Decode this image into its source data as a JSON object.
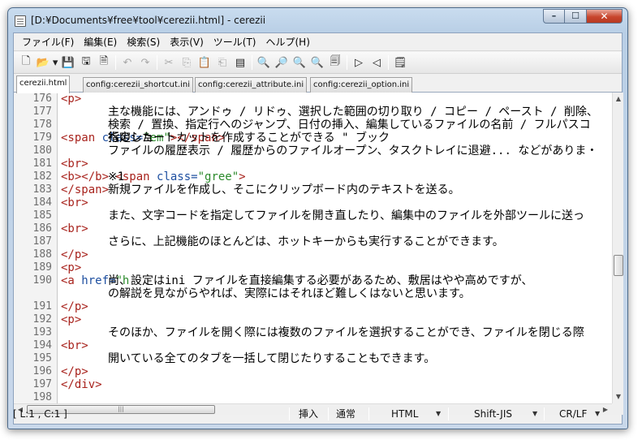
{
  "window": {
    "title": "[D:¥Documents¥free¥tool¥cerezii.html] - cerezii"
  },
  "menu": [
    "ファイル(F)",
    "編集(E)",
    "検索(S)",
    "表示(V)",
    "ツール(T)",
    "ヘルプ(H)"
  ],
  "toolbar": {
    "icons": [
      {
        "name": "new-file-icon",
        "glyph": "🗋",
        "enabled": true
      },
      {
        "name": "open-file-icon",
        "glyph": "📂",
        "enabled": true
      },
      {
        "name": "save-icon",
        "glyph": "💾",
        "enabled": true
      },
      {
        "name": "save-as-icon",
        "glyph": "🖫",
        "enabled": true
      },
      {
        "name": "close-file-icon",
        "glyph": "🗎",
        "enabled": true
      },
      {
        "name": "undo-icon",
        "glyph": "↶",
        "enabled": false
      },
      {
        "name": "redo-icon",
        "glyph": "↷",
        "enabled": false
      },
      {
        "name": "cut-icon",
        "glyph": "✂",
        "enabled": false
      },
      {
        "name": "copy-icon",
        "glyph": "⎘",
        "enabled": false
      },
      {
        "name": "paste-icon",
        "glyph": "📋",
        "enabled": true
      },
      {
        "name": "paste-special-icon",
        "glyph": "⎗",
        "enabled": false
      },
      {
        "name": "select-all-icon",
        "glyph": "▤",
        "enabled": true
      },
      {
        "name": "find-icon",
        "glyph": "🔍",
        "enabled": true
      },
      {
        "name": "find-next-icon",
        "glyph": "🔎",
        "enabled": true
      },
      {
        "name": "find-prev-icon",
        "glyph": "🔍",
        "enabled": true
      },
      {
        "name": "replace-icon",
        "glyph": "🔍",
        "enabled": true
      },
      {
        "name": "go-to-line-icon",
        "glyph": "🗐",
        "enabled": true
      },
      {
        "name": "next-tab-icon",
        "glyph": "▷",
        "enabled": true
      },
      {
        "name": "prev-tab-icon",
        "glyph": "◁",
        "enabled": true
      },
      {
        "name": "properties-icon",
        "glyph": "🗒",
        "enabled": true
      }
    ]
  },
  "tabs": [
    {
      "label": "cerezii.html",
      "active": true
    },
    {
      "label": "config:cerezii_shortcut.ini",
      "active": false
    },
    {
      "label": "config:cerezii_attribute.ini",
      "active": false
    },
    {
      "label": "config:cerezii_option.ini",
      "active": false
    }
  ],
  "editor": {
    "lines": [
      {
        "num": "176",
        "segs": [
          [
            "tag",
            "<p>"
          ]
        ]
      },
      {
        "num": "177",
        "segs": [
          [
            "txt",
            "主な機能には、アンドゥ / リドゥ、選択した範囲の切り取り / コピー / ペースト / 削除、"
          ]
        ]
      },
      {
        "num": "178",
        "segs": [
          [
            "txt",
            "検索 / 置換、指定行へのジャンプ、日付の挿入、編集しているファイルの名前 / フルパスコ"
          ]
        ]
      },
      {
        "num": "179",
        "segs": [
          [
            "txt",
            "指定した"
          ],
          [
            "tag",
            "<span "
          ],
          [
            "attr",
            "class="
          ],
          [
            "val",
            "\"em\""
          ],
          [
            "tag",
            ">"
          ],
          [
            "txt",
            "行"
          ],
          [
            "tag",
            "</span>"
          ],
          [
            "txt",
            "へのショートカットを作成することができる \" ブック"
          ]
        ]
      },
      {
        "num": "180",
        "segs": [
          [
            "txt",
            "ファイルの履歴表示 / 履歴からのファイルオープン、タスクトレイに退避... などがありま・"
          ]
        ]
      },
      {
        "num": "181",
        "segs": [
          [
            "tag",
            "<br>"
          ]
        ]
      },
      {
        "num": "182",
        "segs": [
          [
            "tag",
            "<b>"
          ],
          [
            "txt",
            "※1"
          ],
          [
            "tag",
            "</b> <span "
          ],
          [
            "attr",
            "class="
          ],
          [
            "val",
            "\"gree\""
          ],
          [
            "tag",
            ">"
          ]
        ]
      },
      {
        "num": "183",
        "segs": [
          [
            "txt",
            "新規ファイルを作成し、そこにクリップボード内のテキストを送る。"
          ],
          [
            "tag",
            "</span>"
          ]
        ]
      },
      {
        "num": "184",
        "segs": [
          [
            "tag",
            "<br>"
          ]
        ]
      },
      {
        "num": "185",
        "segs": [
          [
            "txt",
            "また、文字コードを指定してファイルを開き直したり、編集中のファイルを外部ツールに送っ"
          ]
        ]
      },
      {
        "num": "186",
        "segs": [
          [
            "tag",
            "<br>"
          ]
        ]
      },
      {
        "num": "187",
        "segs": [
          [
            "txt",
            "さらに、上記機能のほとんどは、ホットキーからも実行することができます。"
          ]
        ]
      },
      {
        "num": "188",
        "segs": [
          [
            "tag",
            "</p>"
          ]
        ]
      },
      {
        "num": "189",
        "segs": [
          [
            "tag",
            "<p>"
          ]
        ]
      },
      {
        "num": "190",
        "segs": [
          [
            "txt",
            "尚、設定はini ファイルを直接編集する必要があるため、敷居はやや高めですが、"
          ],
          [
            "tag",
            "<a "
          ],
          [
            "attr",
            "href="
          ],
          [
            "val",
            "\"h"
          ]
        ]
      },
      {
        "num": "",
        "segs": [
          [
            "txt",
            "の解説を見ながらやれば、実際にはそれほど難しくはないと思います。"
          ]
        ]
      },
      {
        "num": "191",
        "segs": [
          [
            "tag",
            "</p>"
          ]
        ]
      },
      {
        "num": "192",
        "segs": [
          [
            "tag",
            "<p>"
          ]
        ]
      },
      {
        "num": "193",
        "segs": [
          [
            "txt",
            "そのほか、ファイルを開く際には複数のファイルを選択することができ、ファイルを閉じる際"
          ]
        ]
      },
      {
        "num": "194",
        "segs": [
          [
            "tag",
            "<br>"
          ]
        ]
      },
      {
        "num": "195",
        "segs": [
          [
            "txt",
            "開いている全てのタブを一括して閉じたりすることもできます。"
          ]
        ]
      },
      {
        "num": "196",
        "segs": [
          [
            "tag",
            "</p>"
          ]
        ]
      },
      {
        "num": "197",
        "segs": [
          [
            "tag",
            "</div>"
          ]
        ]
      },
      {
        "num": "198",
        "segs": [
          [
            "tag",
            ""
          ]
        ]
      }
    ]
  },
  "status": {
    "position": "[ L:1 , C:1 ]",
    "insert_mode": "挿入",
    "mode": "通常",
    "syntax": "HTML",
    "encoding": "Shift-JIS",
    "newline": "CR/LF"
  },
  "colors": {
    "tag": "#a8231d",
    "attribute": "#1e4fa0",
    "value": "#2b8a2b"
  }
}
